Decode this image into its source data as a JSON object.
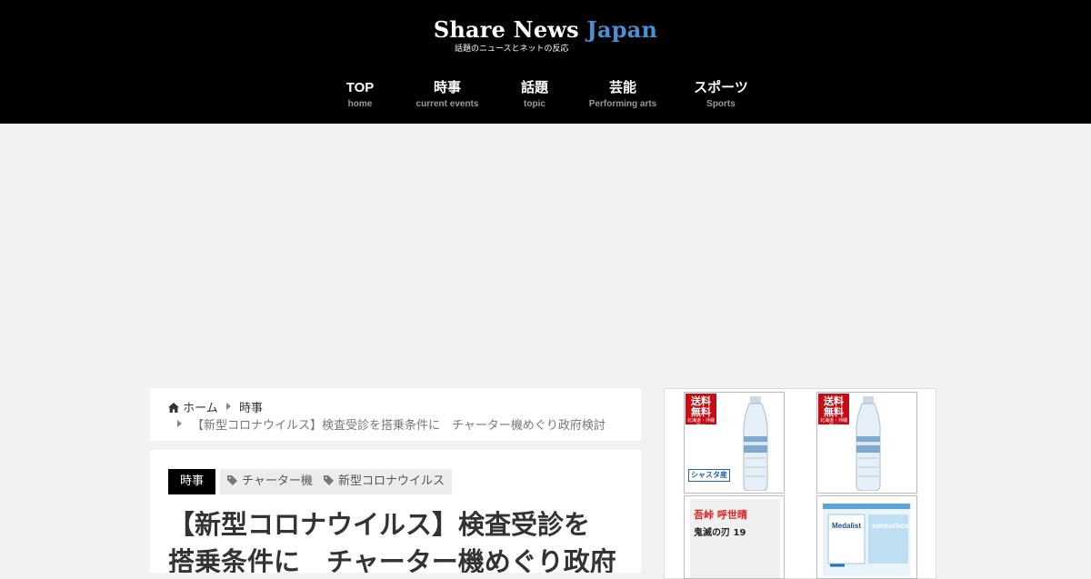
{
  "site": {
    "logo_share_news": "Share News",
    "logo_japan": "Japan",
    "tagline": "話題のニュースとネットの反応"
  },
  "nav": [
    {
      "label": "TOP",
      "sub": "home"
    },
    {
      "label": "時事",
      "sub": "current events"
    },
    {
      "label": "話題",
      "sub": "topic"
    },
    {
      "label": "芸能",
      "sub": "Performing arts"
    },
    {
      "label": "スポーツ",
      "sub": "Sports"
    }
  ],
  "breadcrumb": {
    "home_icon": "home-icon",
    "home": "ホーム",
    "category": "時事",
    "current": "【新型コロナウイルス】検査受診を搭乗条件に　チャーター機めぐり政府検討"
  },
  "article": {
    "category": "時事",
    "tags": [
      "チャーター機",
      "新型コロナウイルス"
    ],
    "tag_icon": "tag-icon",
    "title_line1": "【新型コロナウイルス】検査受診を",
    "title_line2": "搭乗条件に　チャーター機めぐり政府"
  },
  "sidebar": {
    "products": [
      {
        "kind": "water",
        "badge_line1": "送料",
        "badge_line2": "無料",
        "badge_small": "北海道・沖縄除く",
        "origin": "シャスタ産"
      },
      {
        "kind": "water",
        "badge_line1": "送料",
        "badge_line2": "無料",
        "badge_small": "北海道・沖縄除く"
      },
      {
        "kind": "book",
        "author": "吾峠 呼世晴",
        "title": "鬼滅の刃 19"
      },
      {
        "kind": "medical",
        "brand": "Medalist",
        "box_text": "sensorbox"
      }
    ]
  },
  "colors": {
    "header_bg": "#000000",
    "logo_accent": "#4a8fd4",
    "page_bg": "#f2f2f2",
    "badge_bg": "#000000",
    "tag_bg": "#ececec",
    "free_shipping_red": "#c40d14"
  }
}
